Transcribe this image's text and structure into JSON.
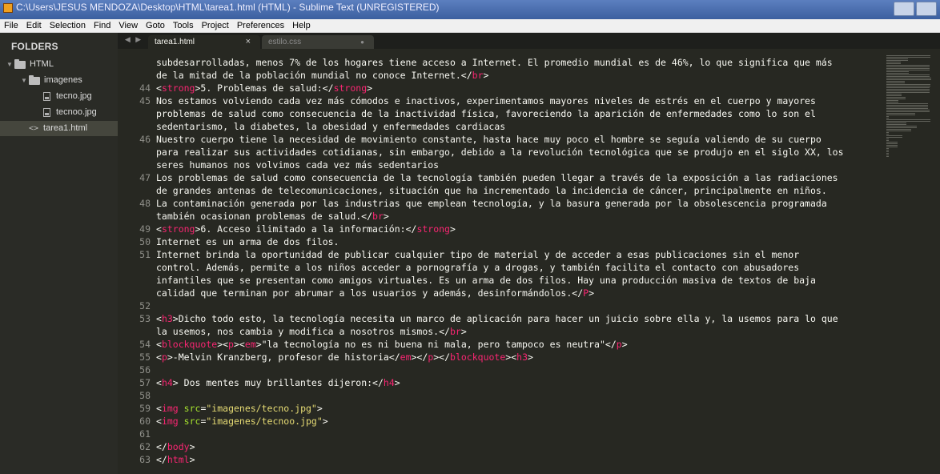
{
  "window": {
    "title": "C:\\Users\\JESUS MENDOZA\\Desktop\\HTML\\tarea1.html (HTML) - Sublime Text (UNREGISTERED)"
  },
  "menu": [
    "File",
    "Edit",
    "Selection",
    "Find",
    "View",
    "Goto",
    "Tools",
    "Project",
    "Preferences",
    "Help"
  ],
  "sidebar": {
    "header": "FOLDERS",
    "tree": [
      {
        "label": "HTML",
        "kind": "folder",
        "level": 0
      },
      {
        "label": "imagenes",
        "kind": "folder",
        "level": 1
      },
      {
        "label": "tecno.jpg",
        "kind": "file",
        "level": 2
      },
      {
        "label": "tecnoo.jpg",
        "kind": "file",
        "level": 2
      },
      {
        "label": "tarea1.html",
        "kind": "code",
        "level": 1,
        "selected": true
      }
    ]
  },
  "tabs": [
    {
      "label": "tarea1.html",
      "active": true,
      "close": "×"
    },
    {
      "label": "estilo.css",
      "active": false,
      "close": "●"
    }
  ],
  "editor": {
    "lines": [
      {
        "n": "",
        "segs": [
          [
            "t",
            "subdesarrolladas, menos 7% de los hogares tiene acceso a Internet. El promedio mundial es de 46%, lo que significa que más"
          ]
        ]
      },
      {
        "n": "",
        "segs": [
          [
            "t",
            "de la mitad de la población mundial no conoce Internet.</"
          ],
          [
            "g",
            "br"
          ],
          [
            "t",
            ">"
          ]
        ]
      },
      {
        "n": "44",
        "segs": [
          [
            "t",
            "<"
          ],
          [
            "g",
            "strong"
          ],
          [
            "t",
            ">5. Problemas de salud:</"
          ],
          [
            "g",
            "strong"
          ],
          [
            "t",
            ">"
          ]
        ]
      },
      {
        "n": "45",
        "segs": [
          [
            "t",
            "Nos estamos volviendo cada vez más cómodos e inactivos, experimentamos mayores niveles de estrés en el cuerpo y mayores"
          ]
        ]
      },
      {
        "n": "",
        "segs": [
          [
            "t",
            "problemas de salud como consecuencia de la inactividad física, favoreciendo la aparición de enfermedades como lo son el"
          ]
        ]
      },
      {
        "n": "",
        "segs": [
          [
            "t",
            "sedentarismo, la diabetes, la obesidad y enfermedades cardiacas"
          ]
        ]
      },
      {
        "n": "46",
        "segs": [
          [
            "t",
            "Nuestro cuerpo tiene la necesidad de movimiento constante, hasta hace muy poco el hombre se seguía valiendo de su cuerpo"
          ]
        ]
      },
      {
        "n": "",
        "segs": [
          [
            "t",
            "para realizar sus actividades cotidianas, sin embargo, debido a la revolución tecnológica que se produjo en el siglo XX, los"
          ]
        ]
      },
      {
        "n": "",
        "segs": [
          [
            "t",
            "seres humanos nos volvimos cada vez más sedentarios"
          ]
        ]
      },
      {
        "n": "47",
        "segs": [
          [
            "t",
            "Los problemas de salud como consecuencia de la tecnología también pueden llegar a través de la exposición a las radiaciones"
          ]
        ]
      },
      {
        "n": "",
        "segs": [
          [
            "t",
            "de grandes antenas de telecomunicaciones, situación que ha incrementado la incidencia de cáncer, principalmente en niños."
          ]
        ]
      },
      {
        "n": "48",
        "segs": [
          [
            "t",
            "La contaminación generada por las industrias que emplean tecnología, y la basura generada por la obsolescencia programada"
          ]
        ]
      },
      {
        "n": "",
        "segs": [
          [
            "t",
            "también ocasionan problemas de salud.</"
          ],
          [
            "g",
            "br"
          ],
          [
            "t",
            ">"
          ]
        ]
      },
      {
        "n": "49",
        "segs": [
          [
            "t",
            "<"
          ],
          [
            "g",
            "strong"
          ],
          [
            "t",
            ">6. Acceso ilimitado a la información:</"
          ],
          [
            "g",
            "strong"
          ],
          [
            "t",
            ">"
          ]
        ]
      },
      {
        "n": "50",
        "segs": [
          [
            "t",
            "Internet es un arma de dos filos."
          ]
        ]
      },
      {
        "n": "51",
        "segs": [
          [
            "t",
            "Internet brinda la oportunidad de publicar cualquier tipo de material y de acceder a esas publicaciones sin el menor"
          ]
        ]
      },
      {
        "n": "",
        "segs": [
          [
            "t",
            "control. Además, permite a los niños acceder a pornografía y a drogas, y también facilita el contacto con abusadores"
          ]
        ]
      },
      {
        "n": "",
        "segs": [
          [
            "t",
            "infantiles que se presentan como amigos virtuales. Es un arma de dos filos. Hay una producción masiva de textos de baja"
          ]
        ]
      },
      {
        "n": "",
        "segs": [
          [
            "t",
            "calidad que terminan por abrumar a los usuarios y además, desinformándolos.</"
          ],
          [
            "g",
            "P"
          ],
          [
            "t",
            ">"
          ]
        ]
      },
      {
        "n": "52",
        "segs": []
      },
      {
        "n": "53",
        "segs": [
          [
            "t",
            "<"
          ],
          [
            "g",
            "h3"
          ],
          [
            "t",
            ">Dicho todo esto, la tecnología necesita un marco de aplicación para hacer un juicio sobre ella y, la usemos para lo que"
          ]
        ]
      },
      {
        "n": "",
        "segs": [
          [
            "t",
            "la usemos, nos cambia y modifica a nosotros mismos.</"
          ],
          [
            "g",
            "br"
          ],
          [
            "t",
            ">"
          ]
        ]
      },
      {
        "n": "54",
        "segs": [
          [
            "t",
            "<"
          ],
          [
            "g",
            "blockquote"
          ],
          [
            "t",
            "><"
          ],
          [
            "g",
            "p"
          ],
          [
            "t",
            "><"
          ],
          [
            "g",
            "em"
          ],
          [
            "t",
            ">\"la tecnología no es ni buena ni mala, pero tampoco es neutra\"</"
          ],
          [
            "g",
            "p"
          ],
          [
            "t",
            ">"
          ]
        ]
      },
      {
        "n": "55",
        "segs": [
          [
            "t",
            "<"
          ],
          [
            "g",
            "p"
          ],
          [
            "t",
            ">-Melvin Kranzberg, profesor de historia</"
          ],
          [
            "g",
            "em"
          ],
          [
            "t",
            "></"
          ],
          [
            "g",
            "p"
          ],
          [
            "t",
            "></"
          ],
          [
            "g",
            "blockquote"
          ],
          [
            "t",
            "><"
          ],
          [
            "g",
            "h3"
          ],
          [
            "t",
            ">"
          ]
        ]
      },
      {
        "n": "56",
        "segs": []
      },
      {
        "n": "57",
        "segs": [
          [
            "t",
            "<"
          ],
          [
            "g",
            "h4"
          ],
          [
            "t",
            "> Dos mentes muy brillantes dijeron:</"
          ],
          [
            "g",
            "h4"
          ],
          [
            "t",
            ">"
          ]
        ]
      },
      {
        "n": "58",
        "segs": []
      },
      {
        "n": "59",
        "segs": [
          [
            "t",
            "<"
          ],
          [
            "g",
            "img"
          ],
          [
            "t",
            " "
          ],
          [
            "a",
            "src"
          ],
          [
            "t",
            "="
          ],
          [
            "s",
            "\"imagenes/tecno.jpg\""
          ],
          [
            "t",
            ">"
          ]
        ]
      },
      {
        "n": "60",
        "segs": [
          [
            "t",
            "<"
          ],
          [
            "g",
            "img"
          ],
          [
            "t",
            " "
          ],
          [
            "a",
            "src"
          ],
          [
            "t",
            "="
          ],
          [
            "s",
            "\"imagenes/tecnoo.jpg\""
          ],
          [
            "t",
            ">"
          ]
        ]
      },
      {
        "n": "61",
        "segs": []
      },
      {
        "n": "62",
        "segs": [
          [
            "t",
            "</"
          ],
          [
            "g",
            "body"
          ],
          [
            "t",
            ">"
          ]
        ]
      },
      {
        "n": "63",
        "segs": [
          [
            "t",
            "</"
          ],
          [
            "g",
            "html"
          ],
          [
            "t",
            ">"
          ]
        ]
      }
    ]
  }
}
